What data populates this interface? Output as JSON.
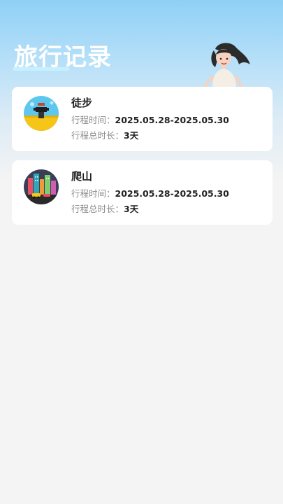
{
  "header": {
    "title": "旅行记录"
  },
  "trips": [
    {
      "name": "徒步",
      "date_label": "行程时间：",
      "date_value": "2025.05.28-2025.05.30",
      "duration_label": "行程总时长：",
      "duration_value": "3天",
      "icon": "hiking-scene-icon"
    },
    {
      "name": "爬山",
      "date_label": "行程时间：",
      "date_value": "2025.05.28-2025.05.30",
      "duration_label": "行程总时长：",
      "duration_value": "3天",
      "icon": "city-scene-icon"
    }
  ],
  "colors": {
    "header_gradient_top": "#8fd0f6",
    "background": "#f4f4f4",
    "card": "#ffffff"
  }
}
